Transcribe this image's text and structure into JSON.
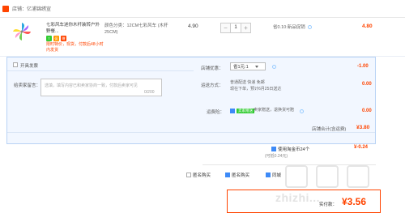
{
  "store": {
    "name": "店铺：亿浦锦绣宣"
  },
  "item": {
    "title": "七彩风车迷你木杆装转户外野餐...",
    "badges": [
      {
        "name": "tmall-badge",
        "color": "#3c3"
      },
      {
        "name": "promo-badge",
        "color": "#f90"
      },
      {
        "name": "gift-badge",
        "color": "#f40"
      }
    ],
    "promo_line1": "限时特价，现货，付款后48小时",
    "promo_line2": "内发货",
    "spec": "颜色分类：12CM七彩风车 (木杆25CM)",
    "price": "4.90",
    "qty": {
      "minus": "−",
      "value": "1",
      "plus": "+"
    },
    "saving": "省0.10:新品促销",
    "subtotal": "4.80"
  },
  "invoice": {
    "label": "开具发票"
  },
  "coupon": {
    "label": "店铺优惠：",
    "selected": "省1元:1",
    "amount": "-1.00"
  },
  "message": {
    "label": "给卖家留言：",
    "placeholder": "选填，填写内容已和卖家协商一致，付款后卖家可见",
    "count": "0/200"
  },
  "shipping": {
    "label": "运送方式：",
    "line1": "普通配送 快递 免邮",
    "line2": "现在下单，预计6月25日送达",
    "amount": "0.00"
  },
  "insurance": {
    "label": "运费险：",
    "tag": "卖家赠送",
    "text": "卖家赠送，退换货可赔",
    "amount": "0.00"
  },
  "store_total": {
    "label": "店铺合计(含运费)",
    "amount": "¥3.80"
  },
  "discount": {
    "label": "使用淘金币24个",
    "note": "(可抵0.24元)",
    "amount": "¥-0.24"
  },
  "options": [
    {
      "label": "匿名购买",
      "checked": false
    },
    {
      "label": "匿名购买",
      "checked": true
    },
    {
      "label": "同城",
      "checked": true
    }
  ],
  "payment": {
    "label": "实付款：",
    "amount": "¥3.56"
  },
  "watermark": {
    "text": "值值值",
    "site": "zhizhi..."
  }
}
